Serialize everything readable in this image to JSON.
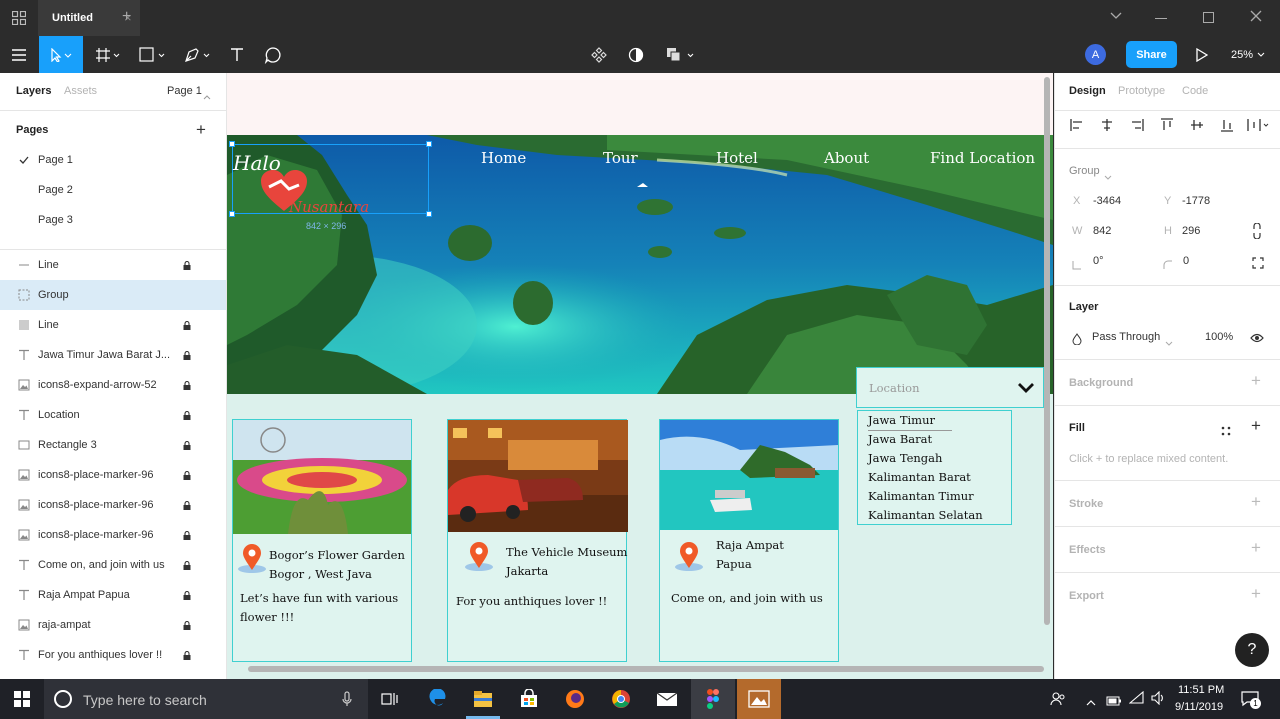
{
  "titlebar": {
    "tab_title": "Untitled"
  },
  "toolbar": {
    "share_label": "Share",
    "zoom": "25%",
    "avatar_initial": "A"
  },
  "left_panel": {
    "tabs": {
      "layers": "Layers",
      "assets": "Assets",
      "page_selector": "Page 1"
    },
    "pages_header": "Pages",
    "pages": [
      "Page 1",
      "Page 2",
      "Page 3"
    ],
    "layers": [
      {
        "name": "Line",
        "icon": "line-icon",
        "locked": true
      },
      {
        "name": "Group",
        "icon": "group-icon",
        "locked": false,
        "selected": true
      },
      {
        "name": "Line",
        "icon": "line-icon",
        "locked": true
      },
      {
        "name": "Jawa Timur Jawa Barat J...",
        "icon": "text-icon",
        "locked": true
      },
      {
        "name": "icons8-expand-arrow-52",
        "icon": "image-icon",
        "locked": true
      },
      {
        "name": "Location",
        "icon": "text-icon",
        "locked": true
      },
      {
        "name": "Rectangle 3",
        "icon": "rectangle-icon",
        "locked": true
      },
      {
        "name": "icons8-place-marker-96",
        "icon": "image-icon",
        "locked": true
      },
      {
        "name": "icons8-place-marker-96",
        "icon": "image-icon",
        "locked": true
      },
      {
        "name": "icons8-place-marker-96",
        "icon": "image-icon",
        "locked": true
      },
      {
        "name": "Come on, and join with us",
        "icon": "text-icon",
        "locked": true
      },
      {
        "name": "Raja Ampat Papua",
        "icon": "text-icon",
        "locked": true
      },
      {
        "name": "raja-ampat",
        "icon": "image-icon",
        "locked": true
      },
      {
        "name": "For you anthiques lover !!",
        "icon": "text-icon",
        "locked": true
      }
    ]
  },
  "canvas": {
    "logo": {
      "halo": "Halo",
      "name": "Nusantara",
      "size_badge": "842 × 296"
    },
    "nav": [
      "Home",
      "Tour",
      "Hotel",
      "About",
      "Find Location"
    ],
    "location_dropdown": {
      "placeholder": "Location",
      "options": [
        "Jawa Timur",
        "Jawa Barat",
        "Jawa Tengah",
        "Kalimantan Barat",
        "Kalimantan Timur",
        "Kalimantan Selatan"
      ]
    },
    "cards": [
      {
        "title_line1": "Bogor’s Flower Garden",
        "title_line2": "Bogor , West Java",
        "desc_line1": "Let’s have fun with various",
        "desc_line2": "flower !!!"
      },
      {
        "title_line1": "The Vehicle Museum",
        "title_line2": "Jakarta",
        "desc_line1": "For you anthiques lover !!",
        "desc_line2": ""
      },
      {
        "title_line1": "Raja Ampat",
        "title_line2": "Papua",
        "desc_line1": "Come on, and join with us",
        "desc_line2": ""
      }
    ]
  },
  "right_panel": {
    "tabs": {
      "design": "Design",
      "prototype": "Prototype",
      "code": "Code"
    },
    "group_label": "Group",
    "x_label": "X",
    "x": "-3464",
    "y_label": "Y",
    "y": "-1778",
    "w_label": "W",
    "w": "842",
    "h_label": "H",
    "h": "296",
    "rotation": "0°",
    "radius": "0",
    "layer_header": "Layer",
    "blend_mode": "Pass Through",
    "opacity": "100%",
    "background": "Background",
    "fill": "Fill",
    "fill_hint": "Click + to replace mixed content.",
    "stroke": "Stroke",
    "effects": "Effects",
    "export": "Export",
    "help": "?"
  },
  "taskbar": {
    "search_placeholder": "Type here to search",
    "time": "11:51 PM",
    "date": "9/11/2019",
    "notification_count": "1"
  },
  "colors": {
    "accent": "#18a0fb",
    "card_border": "#3fd0d0",
    "marker": "#f05a28",
    "logo_red": "#e8453c"
  }
}
